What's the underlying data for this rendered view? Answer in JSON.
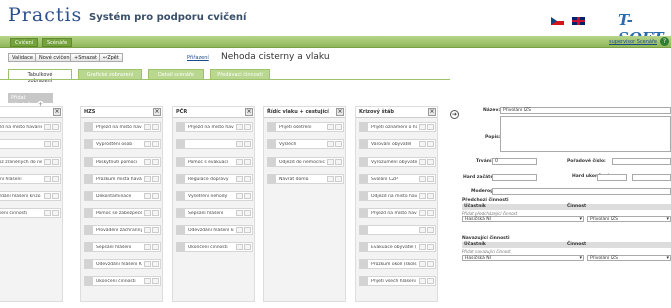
{
  "header": {
    "logo": "Practis",
    "subtitle": "Systém pro podporu cvičení",
    "brand": "T-SOFT"
  },
  "topnav": {
    "tabs": [
      "Cvičení",
      "Scénáře"
    ],
    "user": "supervisor Scenáře"
  },
  "toolbar": {
    "validate": "Validace",
    "new": "Nové cvičení",
    "delete": "+Smazat",
    "back": "Zpět",
    "assign_link": "Přiřazení",
    "scenario_title": "Nehoda cisterny a vlaku"
  },
  "tabs": [
    "Tabulkové zobrazení",
    "Grafické zobrazení",
    "Detail scénáře",
    "Předávací činnosti"
  ],
  "pool_button": "Přidat účastníka",
  "columns": [
    {
      "title": "",
      "cards": [
        "ezd na místo havárie",
        "",
        "voz zraněných do ne",
        "ální hlášení",
        "vzdání hlášení krizo",
        "ešení činnosti"
      ]
    },
    {
      "title": "HZS",
      "cards": [
        "Příjezd na místo havárie",
        "Vyprošťění osob",
        "Poskytnutí pomoci",
        "Průzkum místa havárie",
        "Dekontaminace",
        "Pomoc se zabezpečením",
        "Provádění záchranných",
        "Sepsání hlášení",
        "Odevzdání hlášení KŠ",
        "Ukončení činnosti"
      ]
    },
    {
      "title": "PČR",
      "cards": [
        "Příjezd na místo havárie",
        "",
        "Pomoc s evakuací",
        "Regulace dopravy",
        "Vyšetření nehody",
        "Sepsání hlášení",
        "Odevzdání hlášení krize",
        "Ukončení činnosti"
      ]
    },
    {
      "title": "Řídíc vlaku + cestující",
      "cards": [
        "Přijetí ošetření",
        "Výslech",
        "Odjezd do nemocnice",
        "Návrat domů"
      ]
    },
    {
      "title": "Krizový štáb",
      "cards": [
        "Přijetí oznámení o havár",
        "Varování obyvatel",
        "Vyrozumění obyvatel",
        "Svolání ČŽP",
        "Odjezd na místo havárie",
        "Příjezd na místo havárie",
        "",
        "Evakuace obyvatel (234",
        "Průzkum okolí (školská i",
        "Přijetí všech hlášení od",
        "Předání návrhu starosti",
        "Ukončení činnosti"
      ]
    }
  ],
  "detail": {
    "name_label": "Název:",
    "name_value": "Přivolání IZS",
    "popis_label": "Popis:",
    "trvani_label": "Trvání:",
    "trvani_value": "0",
    "poradi_label": "Pořadové číslo:",
    "hard_start_label": "Hard začátek:",
    "hard_start_value": "",
    "hard_end_label": "Hard ukončení:",
    "hard_end_value": "",
    "moderator_label": "Moderogr:",
    "prior_section": "Předchozí činnosti",
    "col_ucastnik": "Účastník",
    "col_cinnost": "Činnost",
    "prior_hint": "Přidat předcházející činnost",
    "prior_row_participant": "Hasičská Nl",
    "prior_row_activity": "Přivolání IZS",
    "next_section": "Navazující činnosti",
    "next_hint": "Přidat navazující činnost",
    "next_row_participant": "Hasičská Nl",
    "next_row_activity": "Přivolání IZS"
  },
  "colors": {
    "accent_green": "#8fb75a",
    "tab_green": "#b9d78f",
    "link_blue": "#1b4b8a"
  }
}
